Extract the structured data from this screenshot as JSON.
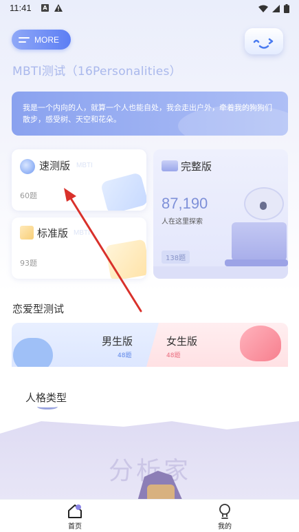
{
  "status_bar": {
    "time": "11:41"
  },
  "header": {
    "more_label": "MORE",
    "title": "MBTI测试（16Personalities）"
  },
  "quote": {
    "text": "我是一个内向的人，就算一个人也能自处，我会走出户外，牵着我的狗狗们散步，感受树、天空和花朵。"
  },
  "cards": {
    "quick": {
      "title": "速测版",
      "tag": "MBTI",
      "count": "60题"
    },
    "standard": {
      "title": "标准版",
      "tag": "MBTI",
      "count": "93题"
    },
    "full": {
      "title": "完整版",
      "number": "87,190",
      "subtitle": "人在这里探索",
      "badge": "138题"
    }
  },
  "love": {
    "section_title": "恋爱型测试",
    "male": {
      "title": "男生版",
      "count": "48题"
    },
    "female": {
      "title": "女生版",
      "count": "48题"
    }
  },
  "types": {
    "section_title": "人格类型",
    "current_type": "分析家"
  },
  "bottom_nav": {
    "home_label": "首页",
    "mine_label": "我的"
  },
  "colors": {
    "accent": "#5c7ef4",
    "annotation_arrow": "#d9312b",
    "male_accent": "#5d86e8",
    "female_accent": "#e96a7c"
  }
}
